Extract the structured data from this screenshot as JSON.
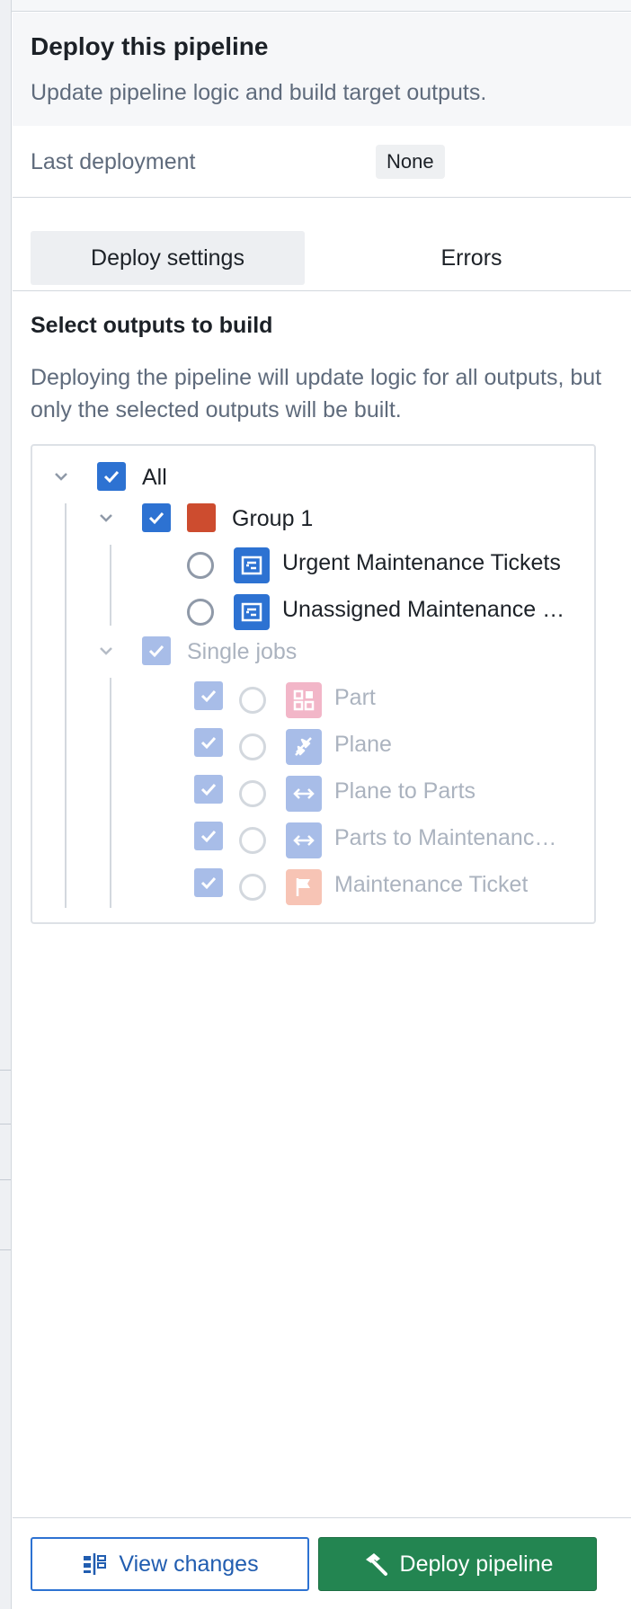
{
  "header": {
    "title": "Deploy this pipeline",
    "subtitle": "Update pipeline logic and build target outputs."
  },
  "last_deployment": {
    "label": "Last deployment",
    "value": "None"
  },
  "tabs": [
    {
      "label": "Deploy settings",
      "active": true
    },
    {
      "label": "Errors",
      "active": false
    }
  ],
  "outputs": {
    "title": "Select outputs to build",
    "description": "Deploying the pipeline will update logic for all outputs, but only the selected outputs will be built.",
    "tree": {
      "all_label": "All",
      "group": {
        "label": "Group 1",
        "color": "#cd4c2f",
        "items": [
          {
            "label": "Urgent Maintenance Tickets",
            "icon": "dataset-output-icon"
          },
          {
            "label": "Unassigned Maintenance …",
            "icon": "dataset-output-icon"
          }
        ]
      },
      "single_jobs": {
        "label": "Single jobs",
        "items": [
          {
            "label": "Part",
            "icon": "grid-icon",
            "icon_color": "#f2b6c8"
          },
          {
            "label": "Plane",
            "icon": "airplane-icon",
            "icon_color": "#a8bde8"
          },
          {
            "label": "Plane to Parts",
            "icon": "link-arrows-icon",
            "icon_color": "#a8bde8"
          },
          {
            "label": "Parts to Maintenanc…",
            "icon": "link-arrows-icon",
            "icon_color": "#a8bde8"
          },
          {
            "label": "Maintenance Ticket",
            "icon": "flag-icon",
            "icon_color": "#f7c4b5"
          }
        ]
      }
    }
  },
  "footer": {
    "view_changes_label": "View changes",
    "deploy_label": "Deploy pipeline"
  },
  "colors": {
    "accent": "#2d72d2",
    "primary_button": "#238551"
  }
}
